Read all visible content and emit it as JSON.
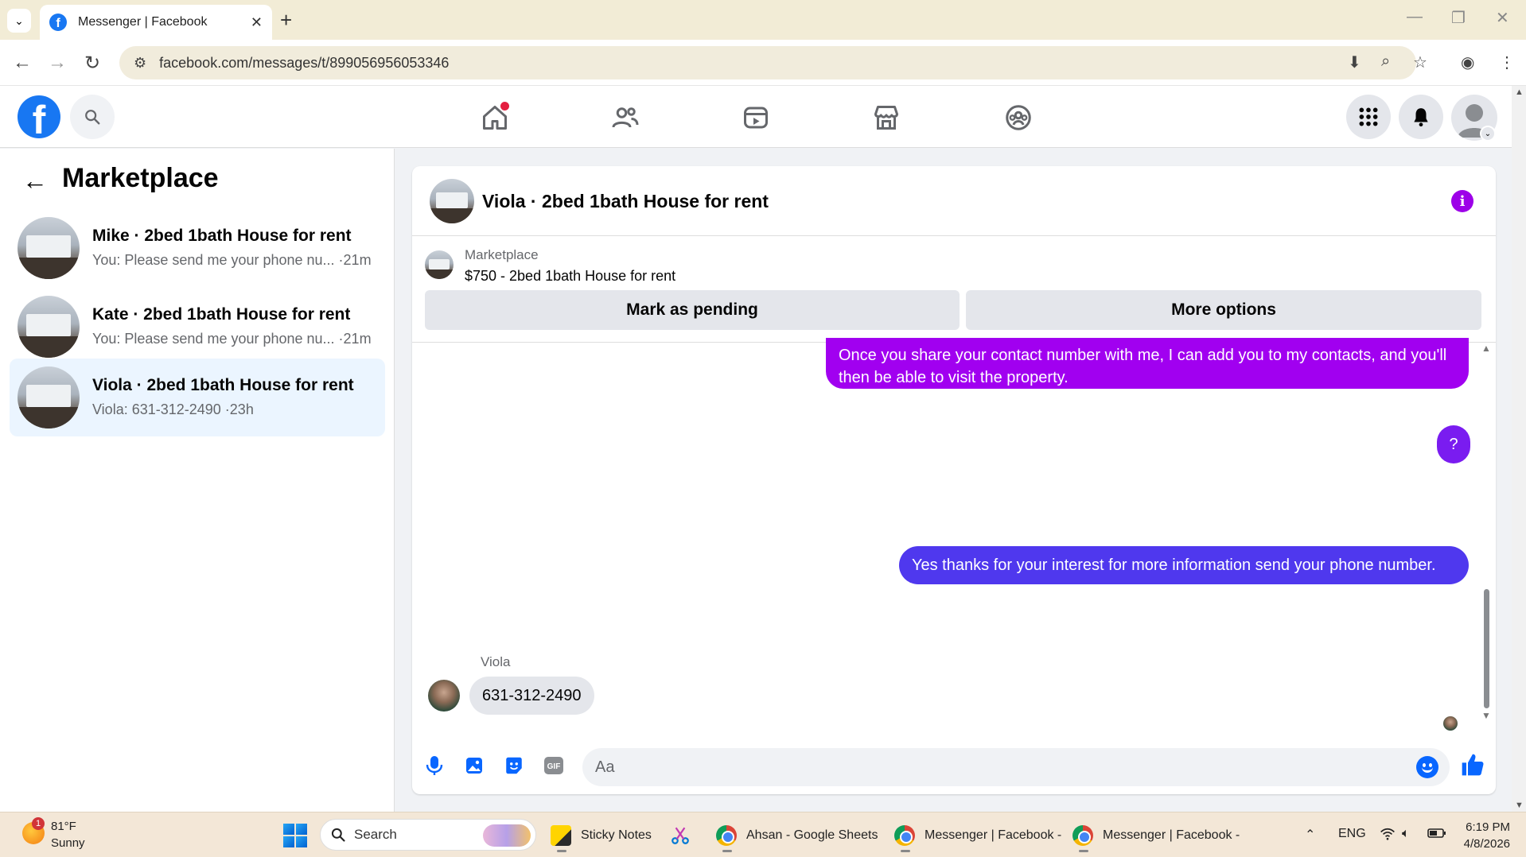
{
  "browser": {
    "tab_title": "Messenger | Facebook",
    "url": "facebook.com/messages/t/899056956053346"
  },
  "sidebar": {
    "title": "Marketplace",
    "conversations": [
      {
        "name": "Mike · 2bed 1bath House for rent",
        "snippet": "You: Please send me your phone nu... ·21m",
        "active": false
      },
      {
        "name": "Kate · 2bed 1bath House for rent",
        "snippet": "You: Please send me your phone nu... ·21m",
        "active": false
      },
      {
        "name": "Viola · 2bed 1bath House for rent",
        "snippet": "Viola: 631-312-2490 ·23h",
        "active": true
      }
    ]
  },
  "chat": {
    "title": "Viola · 2bed 1bath House for rent",
    "listing": {
      "source": "Marketplace",
      "item": "$750 - 2bed 1bath House for rent",
      "mark_pending_label": "Mark as pending",
      "more_options_label": "More options"
    },
    "messages": {
      "out1": "Once you share your contact number with me, I can add you to my contacts, and you'll then be able to visit the property.",
      "out2": "?",
      "out3": "Yes thanks for your interest for more information send your phone number.",
      "sender": "Viola",
      "in1": "631-312-2490"
    },
    "composer_placeholder": "Aa"
  },
  "taskbar": {
    "weather_temp": "81°F",
    "weather_desc": "Sunny",
    "weather_badge": "1",
    "search_label": "Search",
    "apps": [
      {
        "label": "Sticky Notes"
      },
      {
        "label": "Ahsan - Google Sheets"
      },
      {
        "label": "Messenger | Facebook -"
      },
      {
        "label": "Messenger | Facebook -"
      }
    ],
    "lang": "ENG",
    "time": "6:19 PM",
    "date": "4/8/2026"
  },
  "colors": {
    "brand": "#1877f2",
    "bubble_purple": "#a100f0",
    "bubble_blue": "#4f38ee",
    "active_conv": "#ebf5ff"
  }
}
